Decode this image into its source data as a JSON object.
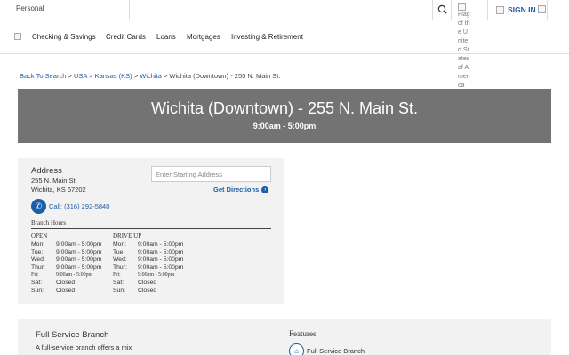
{
  "topbar": {
    "segment_label": "Personal",
    "flag_alt": "Flag of the United States of America",
    "sign_in_label": "SIGN IN"
  },
  "nav": {
    "items": [
      "Checking & Savings",
      "Credit Cards",
      "Loans",
      "Mortgages",
      "Investing & Retirement"
    ]
  },
  "breadcrumb": {
    "items": [
      "Back To Search",
      "USA",
      "Kansas (KS)",
      "Wichita"
    ],
    "separator": ">",
    "current": "Wichita (Downtown) - 255 N. Main St."
  },
  "hero": {
    "title": "Wichita (Downtown) - 255 N. Main St.",
    "hours": "9:00am - 5:00pm"
  },
  "branch": {
    "address_heading": "Address",
    "address_line1": "255 N. Main St.",
    "address_line2": "Wichita, KS 67202",
    "start_placeholder": "Enter Starting Address",
    "get_directions_label": "Get Directions",
    "call_label": "Call: (316) 292-5840",
    "hours_heading": "Branch Hours",
    "open_heading": "OPEN",
    "drive_heading": "DRIVE UP",
    "open_hours": [
      {
        "day": "Mon:",
        "time": "9:00am - 5:00pm"
      },
      {
        "day": "Tue:",
        "time": "9:00am - 5:00pm"
      },
      {
        "day": "Wed:",
        "time": "9:00am - 5:00pm"
      },
      {
        "day": "Thur:",
        "time": "9:00am - 5:00pm"
      },
      {
        "day": "Fri:",
        "time": "9:00am - 5:00pm"
      },
      {
        "day": "Sat:",
        "time": "Closed"
      },
      {
        "day": "Sun:",
        "time": "Closed"
      }
    ],
    "drive_hours": [
      {
        "day": "Mon:",
        "time": "9:00am - 5:00pm"
      },
      {
        "day": "Tue:",
        "time": "9:00am - 5:00pm"
      },
      {
        "day": "Wed:",
        "time": "9:00am - 5:00pm"
      },
      {
        "day": "Thur:",
        "time": "9:00am - 5:00pm"
      },
      {
        "day": "Fri:",
        "time": "9:00am - 5:00pm"
      },
      {
        "day": "Sat:",
        "time": "Closed"
      },
      {
        "day": "Sun:",
        "time": "Closed"
      }
    ]
  },
  "service": {
    "title": "Full Service Branch",
    "description": "A full-service branch offers a mix",
    "features_heading": "Features",
    "feature_label": "Full Service Branch"
  },
  "colors": {
    "link": "#1a5ea8",
    "hero_bg": "#737373",
    "card_bg": "#f2f2f2"
  },
  "icons": [
    "search-icon",
    "flag-icon",
    "user-icon",
    "logo-icon",
    "phone-icon",
    "chevron-right-icon",
    "bank-icon"
  ]
}
